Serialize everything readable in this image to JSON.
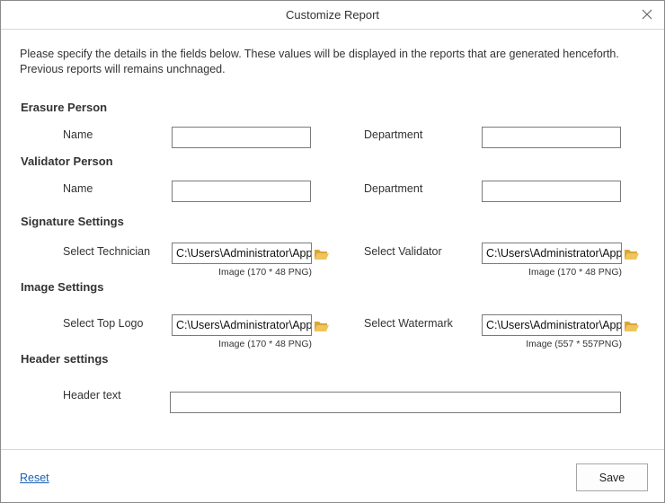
{
  "dialog": {
    "title": "Customize Report"
  },
  "intro": "Please specify the details in the fields below. These values will be displayed in the reports that are generated henceforth. Previous reports will remains unchnaged.",
  "erasure": {
    "heading": "Erasure Person",
    "name_label": "Name",
    "name_value": "",
    "department_label": "Department",
    "department_value": ""
  },
  "validator": {
    "heading": "Validator Person",
    "name_label": "Name",
    "name_value": "",
    "department_label": "Department",
    "department_value": ""
  },
  "signature": {
    "heading": "Signature Settings",
    "technician_label": "Select Technician",
    "technician_path": "C:\\Users\\Administrator\\AppData",
    "technician_hint": "Image (170 * 48 PNG)",
    "validator_label": "Select Validator",
    "validator_path": "C:\\Users\\Administrator\\AppData",
    "validator_hint": "Image (170 * 48 PNG)"
  },
  "image": {
    "heading": "Image Settings",
    "logo_label": "Select Top Logo",
    "logo_path": "C:\\Users\\Administrator\\AppData",
    "logo_hint": "Image (170 * 48 PNG)",
    "watermark_label": "Select Watermark",
    "watermark_path": "C:\\Users\\Administrator\\AppData",
    "watermark_hint": "Image (557 * 557PNG)"
  },
  "header": {
    "heading": "Header settings",
    "text_label": "Header text",
    "text_value": ""
  },
  "footer": {
    "reset_label": "Reset",
    "save_label": "Save"
  },
  "icons": {
    "close": "close-icon",
    "folder": "folder-open-icon"
  },
  "colors": {
    "link": "#1a5fb4",
    "folder": "#e8b84a",
    "border": "#7a7a7a"
  }
}
